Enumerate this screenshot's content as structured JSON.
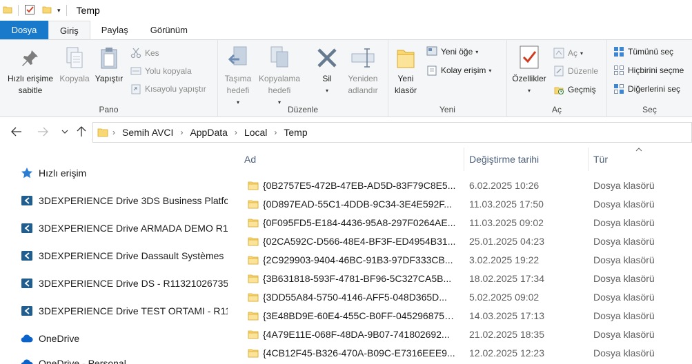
{
  "window": {
    "title": "Temp"
  },
  "tabs": [
    {
      "label": "Dosya"
    },
    {
      "label": "Giriş"
    },
    {
      "label": "Paylaş"
    },
    {
      "label": "Görünüm"
    }
  ],
  "ribbon": {
    "pano": {
      "label": "Pano",
      "pin": "Hızlı erişime\nsabitle",
      "pin_l1": "Hızlı erişime",
      "pin_l2": "sabitle",
      "copy": "Kopyala",
      "paste": "Yapıştır",
      "cut": "Kes",
      "copy_path": "Yolu kopyala",
      "paste_shortcut": "Kısayolu yapıştır"
    },
    "duzenle": {
      "label": "Düzenle",
      "move_l1": "Taşıma",
      "move_l2": "hedefi",
      "copyto_l1": "Kopyalama",
      "copyto_l2": "hedefi",
      "delete": "Sil",
      "rename_l1": "Yeniden",
      "rename_l2": "adlandır"
    },
    "yeni": {
      "label": "Yeni",
      "newfolder_l1": "Yeni",
      "newfolder_l2": "klasör",
      "new_item": "Yeni öğe",
      "easy_access": "Kolay erişim"
    },
    "ac": {
      "label": "Aç",
      "properties": "Özellikler",
      "open": "Aç",
      "edit": "Düzenle",
      "history": "Geçmiş"
    },
    "sec": {
      "label": "Seç",
      "select_all": "Tümünü seç",
      "select_none": "Hiçbirini seçme",
      "invert": "Diğerlerini seç"
    }
  },
  "address": {
    "crumbs": [
      "Semih AVCI",
      "AppData",
      "Local",
      "Temp"
    ]
  },
  "navpane": {
    "items": [
      {
        "label": "Hızlı erişim",
        "icon": "star-icon"
      },
      {
        "label": "3DEXPERIENCE Drive 3DS Business Platfo",
        "icon": "3dexperience-icon"
      },
      {
        "label": "3DEXPERIENCE Drive ARMADA DEMO R1",
        "icon": "3dexperience-icon"
      },
      {
        "label": "3DEXPERIENCE Drive Dassault Systèmes",
        "icon": "3dexperience-icon"
      },
      {
        "label": "3DEXPERIENCE Drive DS - R11321026735",
        "icon": "3dexperience-icon"
      },
      {
        "label": "3DEXPERIENCE Drive TEST ORTAMI - R11",
        "icon": "3dexperience-icon"
      },
      {
        "label": "OneDrive",
        "icon": "onedrive-icon"
      },
      {
        "label": "OneDrive - Personal",
        "icon": "onedrive-icon"
      }
    ]
  },
  "filelist": {
    "columns": {
      "name": "Ad",
      "date": "Değiştirme tarihi",
      "type": "Tür"
    },
    "rows": [
      {
        "name": "{0B2757E5-472B-47EB-AD5D-83F79C8E5...",
        "date": "6.02.2025 10:26",
        "type": "Dosya klasörü"
      },
      {
        "name": "{0D897EAD-55C1-4DDB-9C34-3E4E592F...",
        "date": "11.03.2025 17:50",
        "type": "Dosya klasörü"
      },
      {
        "name": "{0F095FD5-E184-4436-95A8-297F0264AE...",
        "date": "11.03.2025 09:02",
        "type": "Dosya klasörü"
      },
      {
        "name": "{02CA592C-D566-48E4-BF3F-ED4954B31...",
        "date": "25.01.2025 04:23",
        "type": "Dosya klasörü"
      },
      {
        "name": "{2C929903-9404-46BC-91B3-97DF333CB...",
        "date": "3.02.2025 19:22",
        "type": "Dosya klasörü"
      },
      {
        "name": "{3B631818-593F-4781-BF96-5C327CA5B...",
        "date": "18.02.2025 17:34",
        "type": "Dosya klasörü"
      },
      {
        "name": "{3DD55A84-5750-4146-AFF5-048D365D...",
        "date": "5.02.2025 09:02",
        "type": "Dosya klasörü"
      },
      {
        "name": "{3E48BD9E-60E4-455C-B0FF-0452968755...",
        "date": "14.03.2025 17:13",
        "type": "Dosya klasörü"
      },
      {
        "name": "{4A79E11E-068F-48DA-9B07-741802692...",
        "date": "21.02.2025 18:35",
        "type": "Dosya klasörü"
      },
      {
        "name": "{4CB12F45-B326-470A-B09C-E7316EEE9...",
        "date": "12.02.2025 12:23",
        "type": "Dosya klasörü"
      }
    ]
  },
  "colors": {
    "file_tab": "#1979ca",
    "folder": "#f8d775",
    "accent": "#0063b1"
  }
}
